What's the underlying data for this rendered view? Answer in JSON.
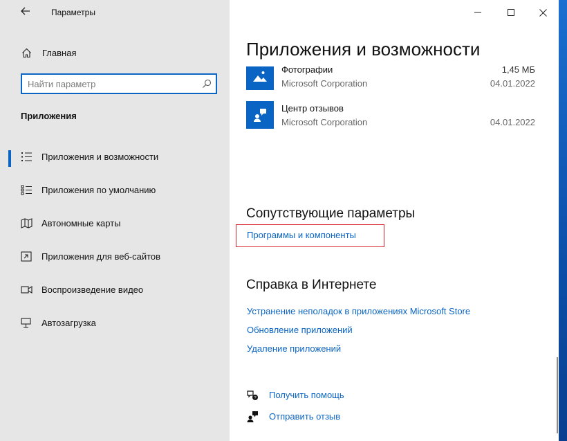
{
  "window": {
    "title": "Параметры"
  },
  "sidebar": {
    "home_label": "Главная",
    "search_placeholder": "Найти параметр",
    "section_title": "Приложения",
    "items": [
      {
        "label": "Приложения и возможности",
        "icon": "apps-list-icon",
        "selected": true
      },
      {
        "label": "Приложения по умолчанию",
        "icon": "default-apps-icon",
        "selected": false
      },
      {
        "label": "Автономные карты",
        "icon": "map-icon",
        "selected": false
      },
      {
        "label": "Приложения для веб-сайтов",
        "icon": "web-apps-icon",
        "selected": false
      },
      {
        "label": "Воспроизведение видео",
        "icon": "video-icon",
        "selected": false
      },
      {
        "label": "Автозагрузка",
        "icon": "startup-icon",
        "selected": false
      }
    ]
  },
  "main": {
    "title": "Приложения и возможности",
    "apps": [
      {
        "name": "Фотографии",
        "publisher": "Microsoft Corporation",
        "size": "1,45 МБ",
        "date": "04.01.2022",
        "icon": "photos-icon"
      },
      {
        "name": "Центр отзывов",
        "publisher": "Microsoft Corporation",
        "size": "",
        "date": "04.01.2022",
        "icon": "feedback-hub-icon"
      }
    ],
    "related": {
      "title": "Сопутствующие параметры",
      "link": "Программы и компоненты"
    },
    "online_help": {
      "title": "Справка в Интернете",
      "links": [
        "Устранение неполадок в приложениях Microsoft Store",
        "Обновление приложений",
        "Удаление приложений"
      ]
    },
    "help_actions": [
      {
        "label": "Получить помощь",
        "icon": "get-help-icon"
      },
      {
        "label": "Отправить отзыв",
        "icon": "send-feedback-icon"
      }
    ]
  },
  "colors": {
    "accent": "#0a64c4",
    "highlight": "#d9232c",
    "sidebar_bg": "#e6e6e6"
  }
}
